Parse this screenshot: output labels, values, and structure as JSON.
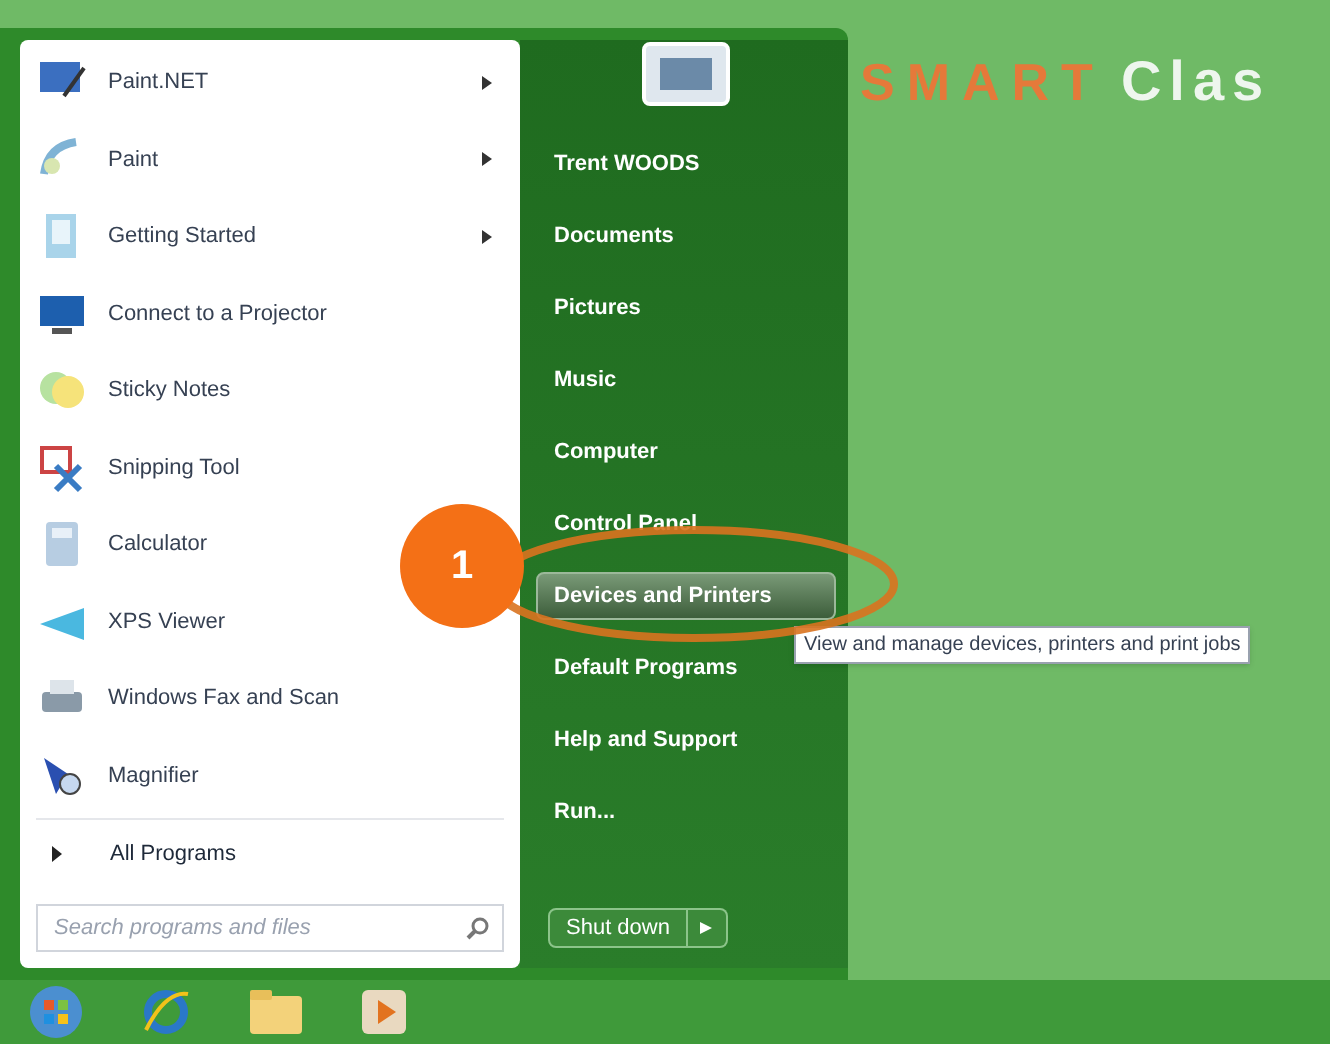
{
  "desktop_logo": {
    "brand": "SMART",
    "word": "Clas"
  },
  "start_menu": {
    "programs": [
      {
        "label": "Paint.NET",
        "has_submenu": true
      },
      {
        "label": "Paint",
        "has_submenu": true
      },
      {
        "label": "Getting Started",
        "has_submenu": true
      },
      {
        "label": "Connect to a Projector",
        "has_submenu": false
      },
      {
        "label": "Sticky Notes",
        "has_submenu": false
      },
      {
        "label": "Snipping Tool",
        "has_submenu": false
      },
      {
        "label": "Calculator",
        "has_submenu": false
      },
      {
        "label": "XPS Viewer",
        "has_submenu": false
      },
      {
        "label": "Windows Fax and Scan",
        "has_submenu": false
      },
      {
        "label": "Magnifier",
        "has_submenu": false
      }
    ],
    "all_programs": "All Programs",
    "search": {
      "placeholder": "Search programs and files"
    },
    "places": [
      {
        "label": "Trent WOODS",
        "selected": false
      },
      {
        "label": "Documents",
        "selected": false
      },
      {
        "label": "Pictures",
        "selected": false
      },
      {
        "label": "Music",
        "selected": false
      },
      {
        "label": "Computer",
        "selected": false
      },
      {
        "label": "Control Panel",
        "selected": false
      },
      {
        "label": "Devices and Printers",
        "selected": true
      },
      {
        "label": "Default Programs",
        "selected": false
      },
      {
        "label": "Help and Support",
        "selected": false
      },
      {
        "label": "Run...",
        "selected": false
      }
    ],
    "shut_down": "Shut down"
  },
  "tooltip": "View and manage devices, printers and print jobs",
  "callout": "1"
}
